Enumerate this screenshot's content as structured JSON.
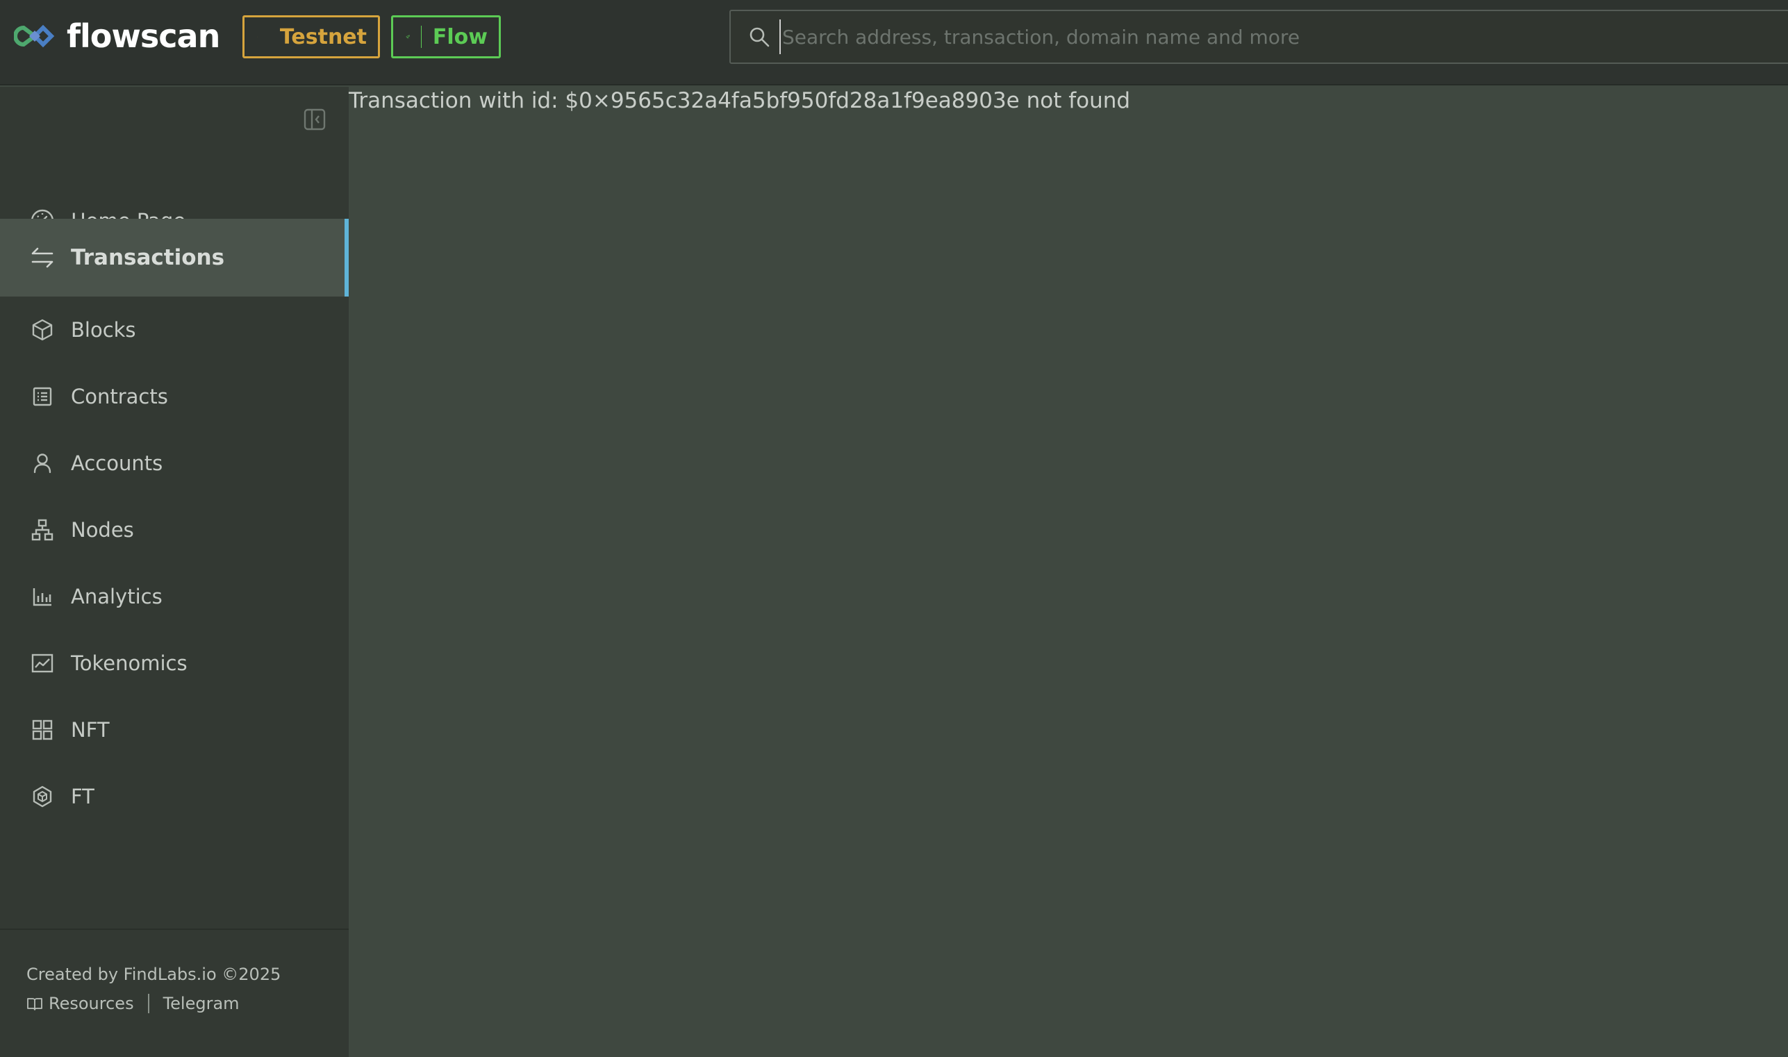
{
  "brand": {
    "name": "flowscan"
  },
  "header": {
    "network_testnet_label": "Testnet",
    "network_flow_label": "Flow",
    "search_placeholder": "Search address, transaction, domain name and more"
  },
  "sidebar": {
    "items": [
      {
        "label": "Home Page",
        "icon": "dashboard-icon"
      },
      {
        "label": "Transactions",
        "icon": "transfer-icon",
        "active": true
      },
      {
        "label": "Blocks",
        "icon": "cube-icon"
      },
      {
        "label": "Contracts",
        "icon": "contract-icon"
      },
      {
        "label": "Accounts",
        "icon": "user-icon"
      },
      {
        "label": "Nodes",
        "icon": "nodes-icon"
      },
      {
        "label": "Analytics",
        "icon": "bar-chart-icon"
      },
      {
        "label": "Tokenomics",
        "icon": "line-chart-icon"
      },
      {
        "label": "NFT",
        "icon": "grid-icon"
      },
      {
        "label": "FT",
        "icon": "token-icon"
      }
    ],
    "footer": {
      "credits": "Created by FindLabs.io ©2025",
      "resources_label": "Resources",
      "telegram_label": "Telegram"
    }
  },
  "main": {
    "error_message": "Transaction with id: $0×9565c32a4fa5bf950fd28a1f9ea8903e not found"
  },
  "colors": {
    "header_bg": "#2e332f",
    "sidebar_bg": "#333933",
    "main_bg": "#3f4840",
    "testnet_accent": "#d6a43d",
    "flow_accent": "#5ccb55",
    "active_indicator": "#5fb4d8"
  }
}
